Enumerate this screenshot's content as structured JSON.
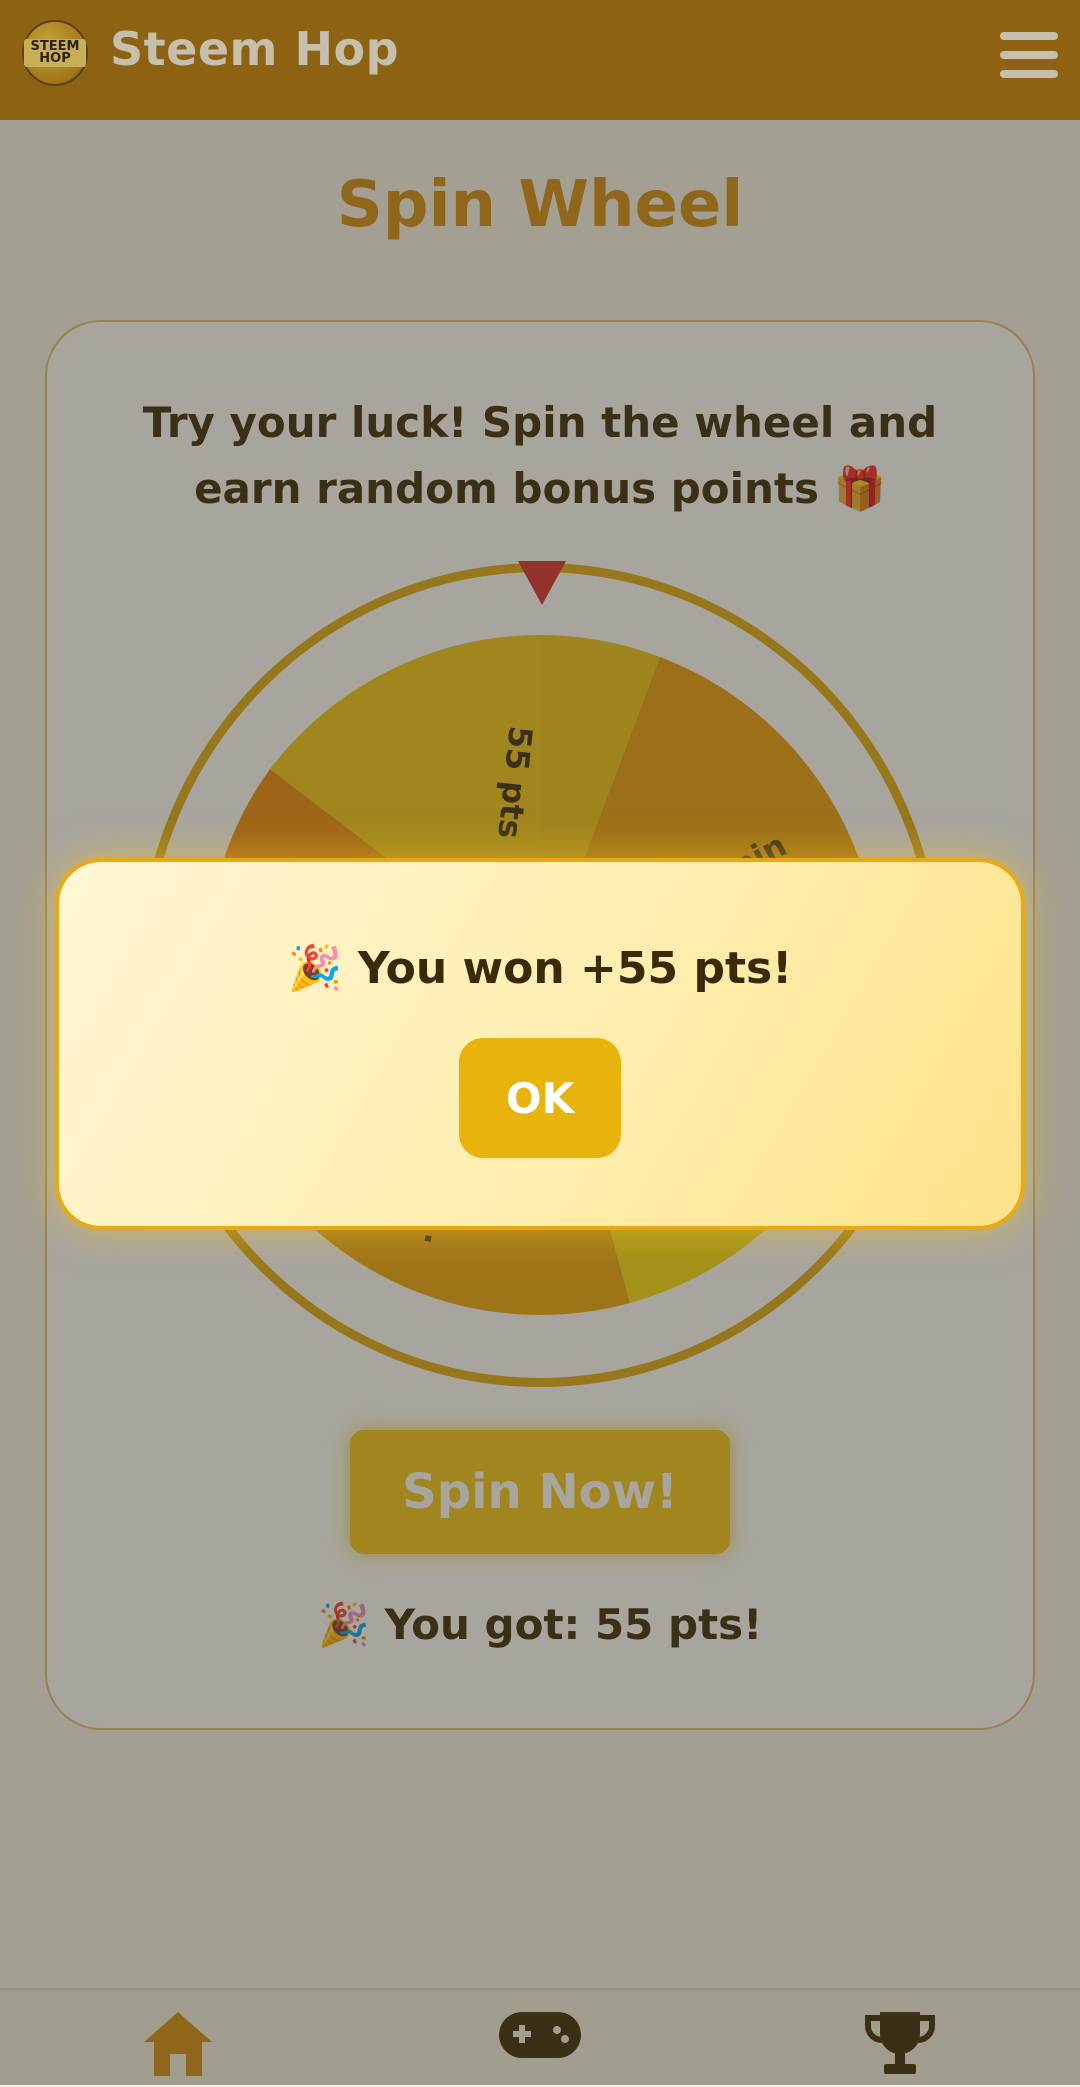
{
  "header": {
    "title": "Steem Hop",
    "logo_text": "STEEM HOP"
  },
  "page": {
    "title": "Spin Wheel",
    "intro": "Try your luck! Spin the wheel and earn random bonus points 🎁",
    "spin_button": "Spin Now!",
    "result": "🎉 You got: 55 pts!"
  },
  "wheel": {
    "segments_visible": [
      "55 pts",
      "...spin",
      "...ts"
    ]
  },
  "modal": {
    "message": "🎉 You won +55 pts!",
    "ok_label": "OK"
  },
  "nav": {
    "items": [
      "home-icon",
      "gamepad-icon",
      "trophy-icon"
    ]
  },
  "colors": {
    "brand": "#a8720c",
    "accent": "#f5c518",
    "title": "#d58f0f",
    "pointer": "#d8312c"
  }
}
